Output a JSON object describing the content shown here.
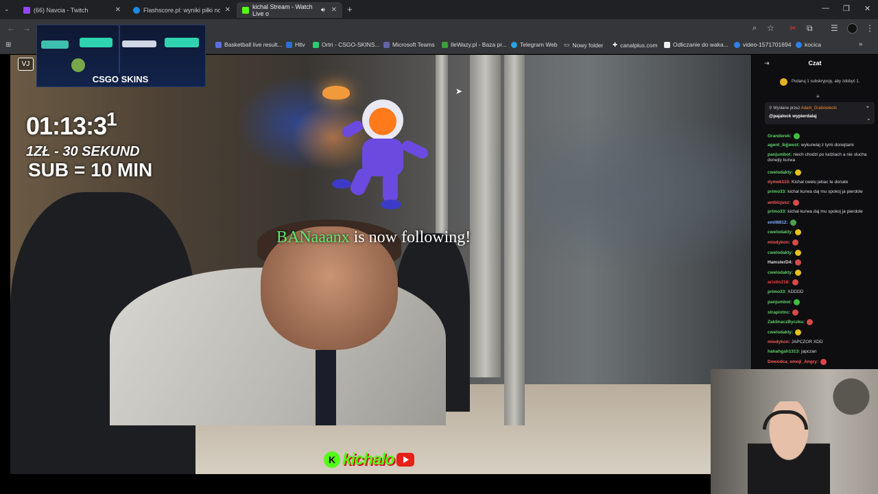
{
  "browser": {
    "tabs": [
      {
        "title": "(66) Navcia - Twitch",
        "favicon_color": "#9146ff",
        "active": false
      },
      {
        "title": "Flashscore.pl: wyniki piłki nożnej",
        "favicon_color": "#1e88e5",
        "active": false
      },
      {
        "title": "kichal Stream - Watch Live o",
        "favicon_color": "#53fc18",
        "active": true
      }
    ],
    "new_tab_label": "+",
    "window_controls": {
      "minimize": "—",
      "restore": "❐",
      "close": "✕"
    },
    "bookmarks": [
      {
        "label": "Basketball live result...",
        "icon_color": "#5b6ee1"
      },
      {
        "label": "Hltv",
        "icon_color": "#2c6fd6"
      },
      {
        "label": "Ortri - CSGO-SKINS...",
        "icon_color": "#2ecc71"
      },
      {
        "label": "Microsoft Teams",
        "icon_color": "#6264a7"
      },
      {
        "label": "IleWazy.pl - Baza pr...",
        "icon_color": "#3aa13a"
      },
      {
        "label": "Telegram Web",
        "icon_color": "#2aa3df"
      },
      {
        "label": "Nowy folder",
        "icon_color": "#cccccc"
      },
      {
        "label": "canalplus.com",
        "icon_color": "#ffffff"
      },
      {
        "label": "Odliczanie do waka...",
        "icon_color": "#eeeeee"
      },
      {
        "label": "video-1571701694",
        "icon_color": "#2f80ed"
      },
      {
        "label": "kocica",
        "icon_color": "#2f80ed"
      }
    ]
  },
  "stream": {
    "timer_main": "01:13:3",
    "timer_digit": "1",
    "rate_text": "1ZŁ - 30 SEKUND",
    "sub_text": "SUB = 10 MIN",
    "follower_name": "BANaaanx",
    "follow_text": " is now following!",
    "banner_brand": "CSGO SKINS",
    "vj_badge": "VJ",
    "logo_k": "K",
    "logo_text": "kichalo"
  },
  "chat": {
    "title": "Czat",
    "sub_prompt": "Podaruj 1 subskrypcję, aby zdobyć 1.",
    "pinned_by_label": "Wysłane przez",
    "pinned_by_user": "Adam_Grabowiecki",
    "pinned_message": "@pajalock wypierdalaj",
    "messages": [
      {
        "user": "Granderek:",
        "text": "",
        "color": "#60d26b",
        "emote": "#3fbf3f"
      },
      {
        "user": "agent_ibjjwest:",
        "text": " wykurwiaj z tymi donejtami",
        "color": "#60d26b",
        "emote": ""
      },
      {
        "user": "panjumbot:",
        "text": " niech chodzi po ludziach a nie slucha donejty kurwa",
        "color": "#60d26b",
        "emote": ""
      },
      {
        "user": "cwelodakty:",
        "text": "",
        "color": "#60d26b",
        "emote": "#e7c01a"
      },
      {
        "user": "dymek110:",
        "text": " Kichal cwelu jebac te donate",
        "color": "#ff5a5a",
        "emote": ""
      },
      {
        "user": "primo33:",
        "text": " kichal kurwa daj mu spokoj ja pierdole",
        "color": "#60d26b",
        "emote": ""
      },
      {
        "user": "ambicjusz:",
        "text": "",
        "color": "#ff5a5a",
        "emote": "#d54a4a"
      },
      {
        "user": "primo33:",
        "text": " kichal kurwa daj mu spokoj ja pierdole",
        "color": "#60d26b",
        "emote": ""
      },
      {
        "user": "emil8812:",
        "text": "",
        "color": "#7ab0ff",
        "emote": "#4aa34a"
      },
      {
        "user": "cwelodakty:",
        "text": "",
        "color": "#60d26b",
        "emote": "#e7c01a"
      },
      {
        "user": "miodykon:",
        "text": "",
        "color": "#ff5a5a",
        "emote": "#d54a4a"
      },
      {
        "user": "cwelodakty:",
        "text": "",
        "color": "#60d26b",
        "emote": "#e7c01a"
      },
      {
        "user": "HamsterD4:",
        "text": "",
        "color": "#dddddd",
        "emote": "#d54a4a"
      },
      {
        "user": "cwelodakty:",
        "text": "",
        "color": "#60d26b",
        "emote": "#e7c01a"
      },
      {
        "user": "aristin218:",
        "text": "",
        "color": "#ff3b3b",
        "emote": "#d54a4a"
      },
      {
        "user": "primo33:",
        "text": " XDDDD",
        "color": "#60d26b",
        "emote": ""
      },
      {
        "user": "panjumbot:",
        "text": "",
        "color": "#60d26b",
        "emote": "#3fbf3f"
      },
      {
        "user": "strapixtnc:",
        "text": "",
        "color": "#60d26b",
        "emote": "#d54a4a"
      },
      {
        "user": "ZaklinaczByczku:",
        "text": "",
        "color": "#60d26b",
        "emote": "#d54a4a"
      },
      {
        "user": "cwelodakty:",
        "text": "",
        "color": "#60d26b",
        "emote": "#e7c01a"
      },
      {
        "user": "miodykon:",
        "text": " JAPCZOR XDD",
        "color": "#ff5a5a",
        "emote": ""
      },
      {
        "user": "hahahgah1313:",
        "text": " japczan",
        "color": "#60d26b",
        "emote": ""
      },
      {
        "user": "Dowodca_emoji_Angry:",
        "text": "",
        "color": "#ff5a5a",
        "emote": "#d54a4a"
      }
    ]
  }
}
